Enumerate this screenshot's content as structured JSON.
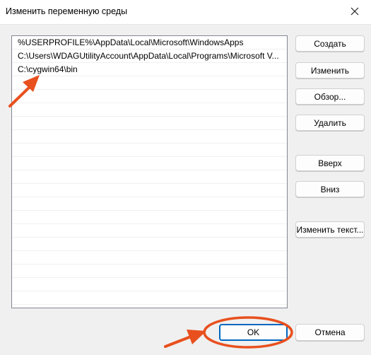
{
  "window": {
    "title": "Изменить переменную среды"
  },
  "list": {
    "items": [
      "%USERPROFILE%\\AppData\\Local\\Microsoft\\WindowsApps",
      "C:\\Users\\WDAGUtilityAccount\\AppData\\Local\\Programs\\Microsoft V...",
      "C:\\cygwin64\\bin"
    ],
    "empty_row_count": 18
  },
  "buttons": {
    "create": "Создать",
    "edit": "Изменить",
    "browse": "Обзор...",
    "delete": "Удалить",
    "up": "Вверх",
    "down": "Вниз",
    "edit_text": "Изменить текст...",
    "ok": "OK",
    "cancel": "Отмена"
  },
  "annotations": {
    "arrow_color": "#e8501e",
    "ellipse_color": "#e8501e"
  },
  "icons": {
    "close": "close-icon"
  },
  "colors": {
    "default_button_border": "#0067c0",
    "list_border": "#828790"
  }
}
